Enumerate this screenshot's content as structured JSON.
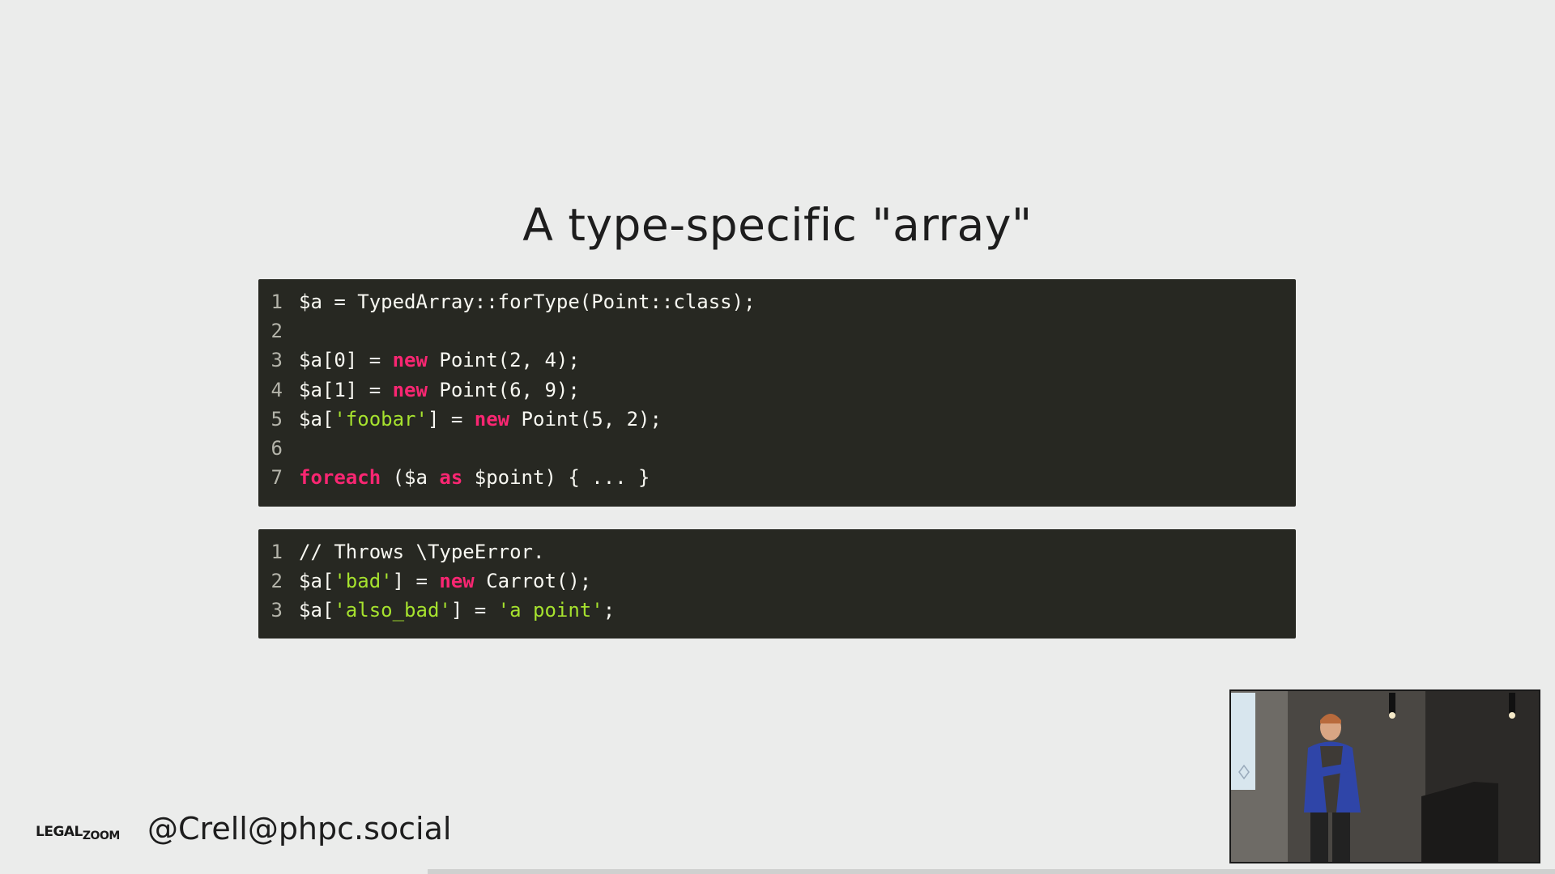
{
  "slide": {
    "title": "A type-specific \"array\"",
    "footer_logo_main": "LEGAL",
    "footer_logo_sub": "ZOOM",
    "footer_handle": "@Crell@phpc.social"
  },
  "code_block_1": {
    "lines": [
      {
        "n": "1",
        "segments": [
          {
            "t": "$a = TypedArray::forType(Point::class);",
            "c": "plain"
          }
        ]
      },
      {
        "n": "2",
        "segments": []
      },
      {
        "n": "3",
        "segments": [
          {
            "t": "$a[0] = ",
            "c": "plain"
          },
          {
            "t": "new",
            "c": "kw"
          },
          {
            "t": " Point(2, 4);",
            "c": "plain"
          }
        ]
      },
      {
        "n": "4",
        "segments": [
          {
            "t": "$a[1] = ",
            "c": "plain"
          },
          {
            "t": "new",
            "c": "kw"
          },
          {
            "t": " Point(6, 9);",
            "c": "plain"
          }
        ]
      },
      {
        "n": "5",
        "segments": [
          {
            "t": "$a[",
            "c": "plain"
          },
          {
            "t": "'foobar'",
            "c": "str"
          },
          {
            "t": "] = ",
            "c": "plain"
          },
          {
            "t": "new",
            "c": "kw"
          },
          {
            "t": " Point(5, 2);",
            "c": "plain"
          }
        ]
      },
      {
        "n": "6",
        "segments": []
      },
      {
        "n": "7",
        "segments": [
          {
            "t": "foreach",
            "c": "kw"
          },
          {
            "t": " ($a ",
            "c": "plain"
          },
          {
            "t": "as",
            "c": "kw"
          },
          {
            "t": " $point) { ... }",
            "c": "plain"
          }
        ]
      }
    ]
  },
  "code_block_2": {
    "lines": [
      {
        "n": "1",
        "segments": [
          {
            "t": "// Throws \\TypeError.",
            "c": "plain"
          }
        ]
      },
      {
        "n": "2",
        "segments": [
          {
            "t": "$a[",
            "c": "plain"
          },
          {
            "t": "'bad'",
            "c": "str"
          },
          {
            "t": "] = ",
            "c": "plain"
          },
          {
            "t": "new",
            "c": "kw"
          },
          {
            "t": " Carrot();",
            "c": "plain"
          }
        ]
      },
      {
        "n": "3",
        "segments": [
          {
            "t": "$a[",
            "c": "plain"
          },
          {
            "t": "'also_bad'",
            "c": "str"
          },
          {
            "t": "] = ",
            "c": "plain"
          },
          {
            "t": "'a point'",
            "c": "str"
          },
          {
            "t": ";",
            "c": "plain"
          }
        ]
      }
    ]
  },
  "video_overlay": {
    "icon": "speaker-video-icon"
  },
  "progress": {
    "fraction": 0.275
  },
  "colors": {
    "background": "#ebeceb",
    "code_bg": "#272822",
    "code_fg": "#f8f8f2",
    "keyword": "#f92672",
    "string": "#a6e22e",
    "line_number": "#b4b4aa"
  }
}
